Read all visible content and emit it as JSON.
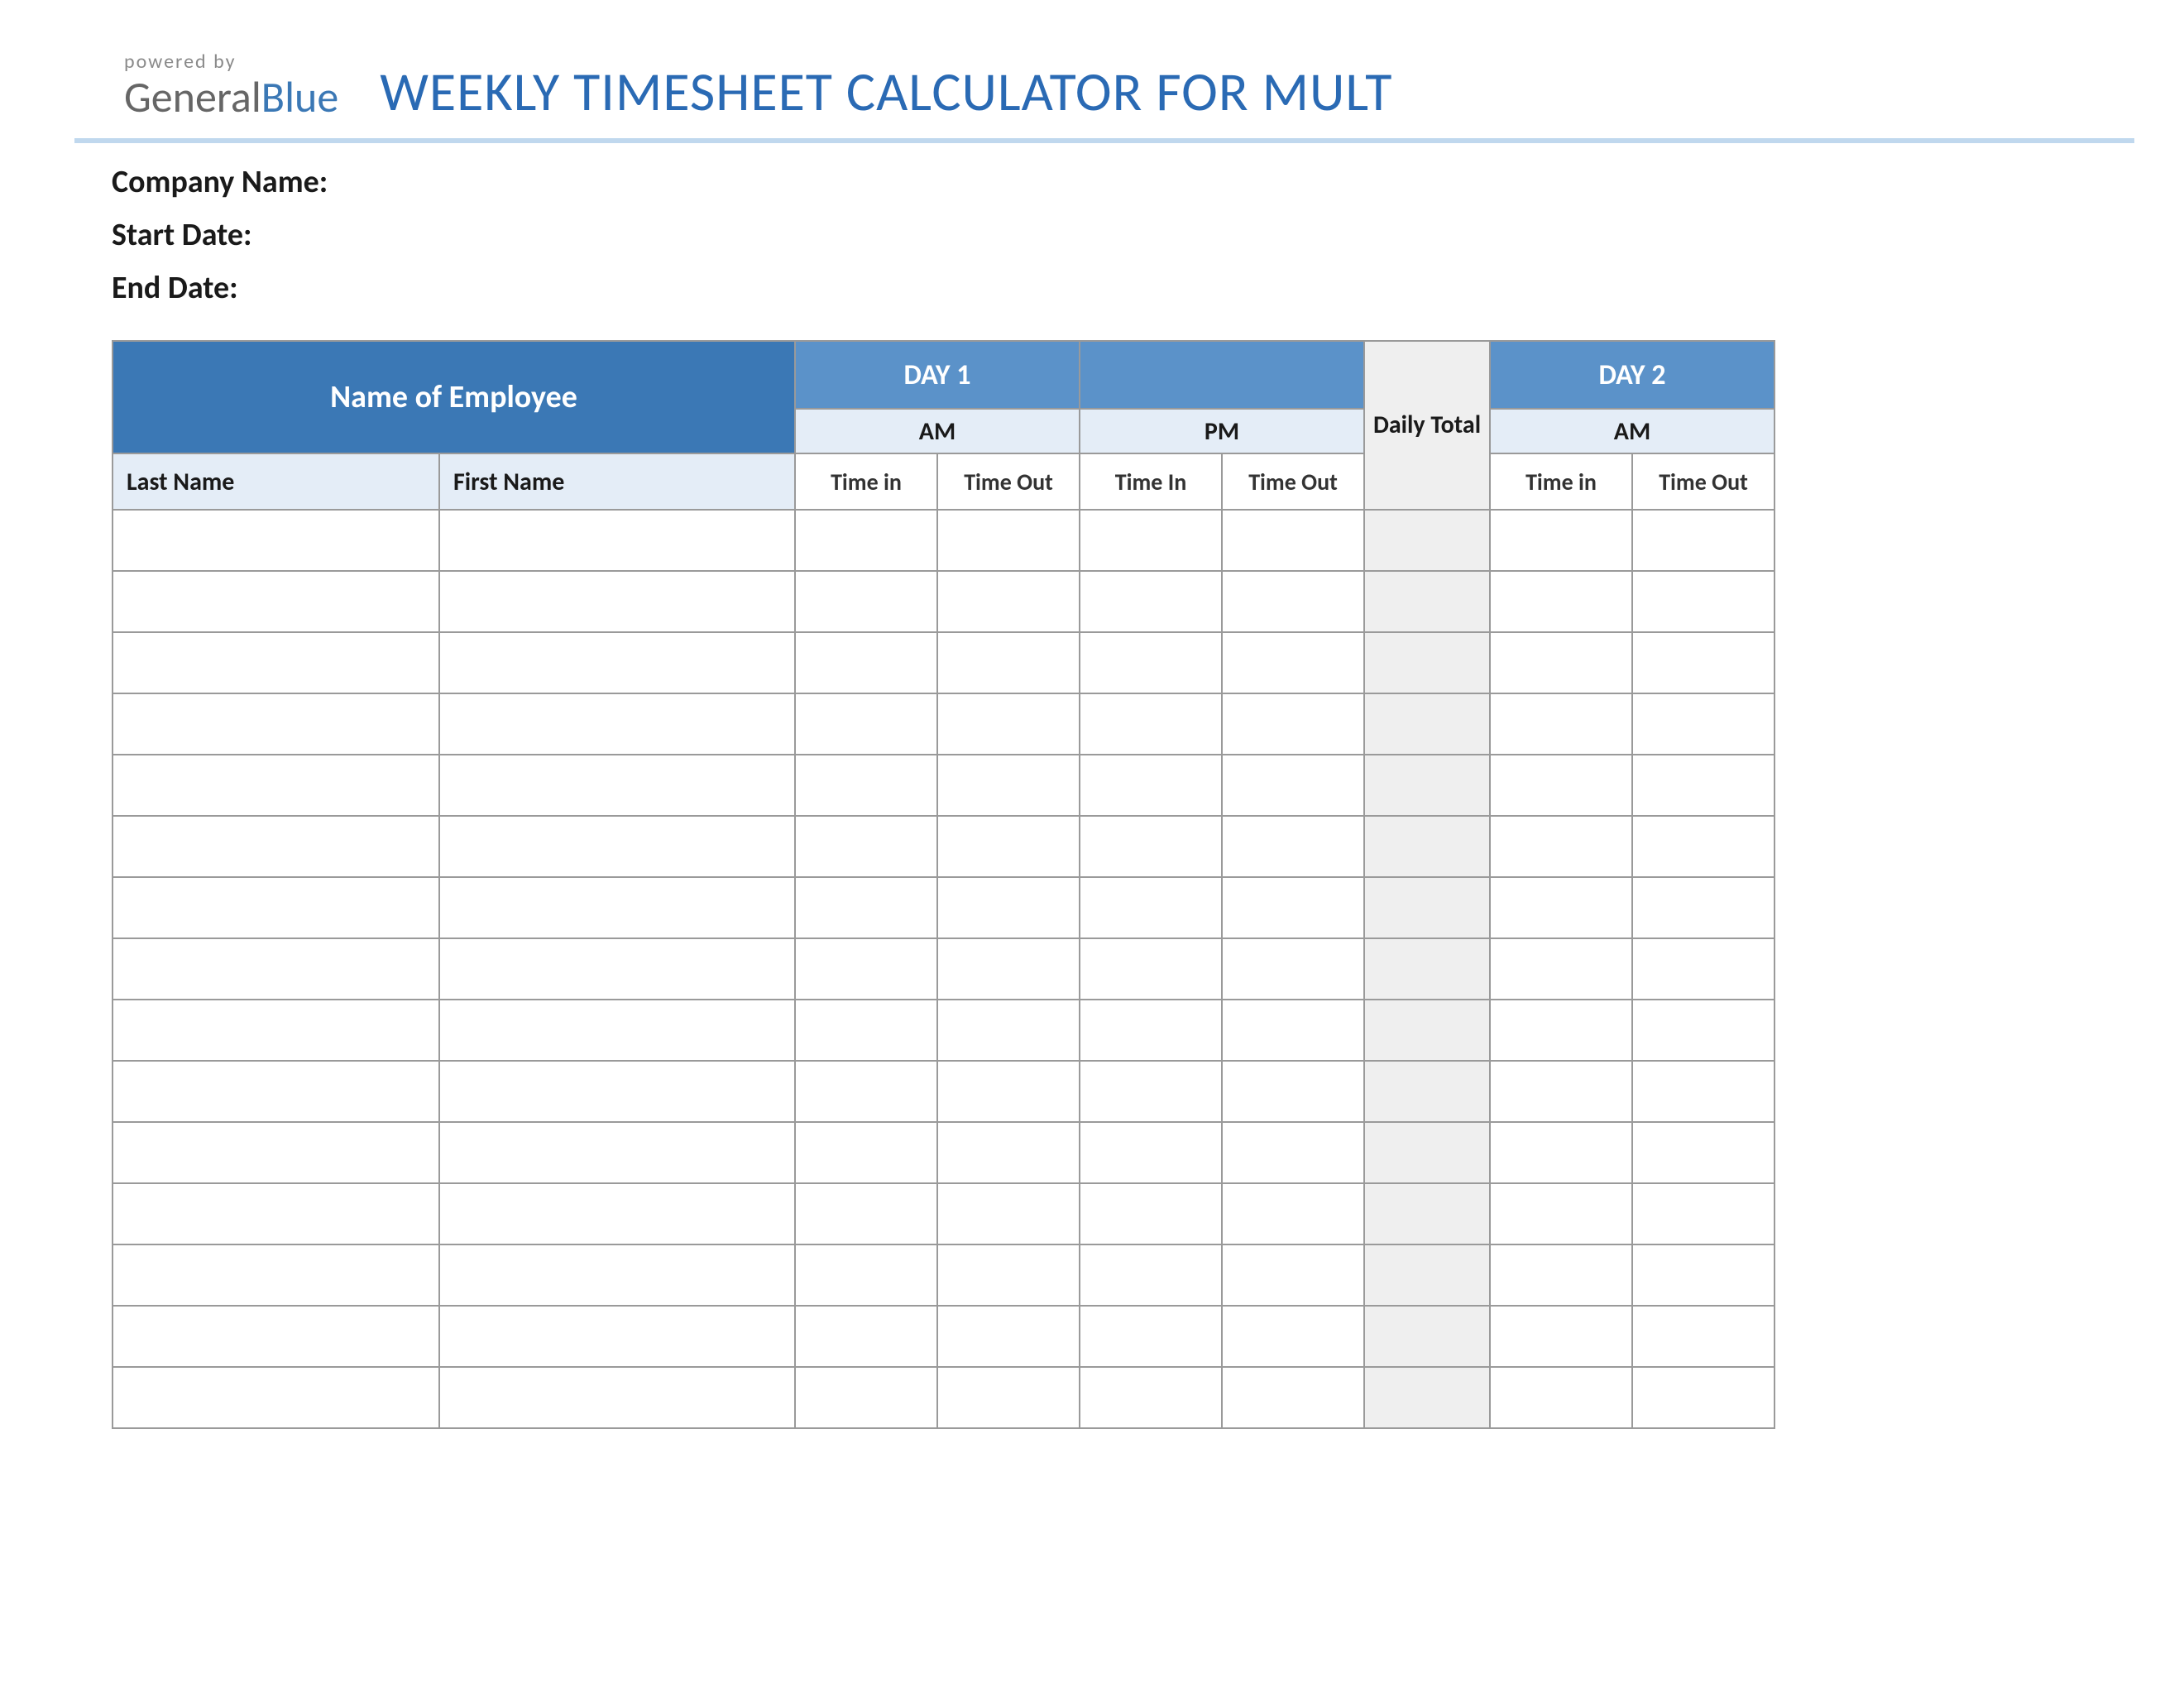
{
  "logo": {
    "powered_by": "powered by",
    "brand_general": "General",
    "brand_blue": "Blue"
  },
  "title": "WEEKLY TIMESHEET CALCULATOR FOR MULT",
  "labels": {
    "company": "Company Name:",
    "start_date": "Start Date:",
    "end_date": "End Date:"
  },
  "headers": {
    "name_of_employee": "Name of Employee",
    "day1": "DAY 1",
    "day2": "DAY 2",
    "am": "AM",
    "pm": "PM",
    "daily_total": "Daily Total",
    "last_name": "Last Name",
    "first_name": "First Name",
    "time_in": "Time in",
    "time_out": "Time Out",
    "time_in_caps": "Time In"
  },
  "row_count": 15
}
